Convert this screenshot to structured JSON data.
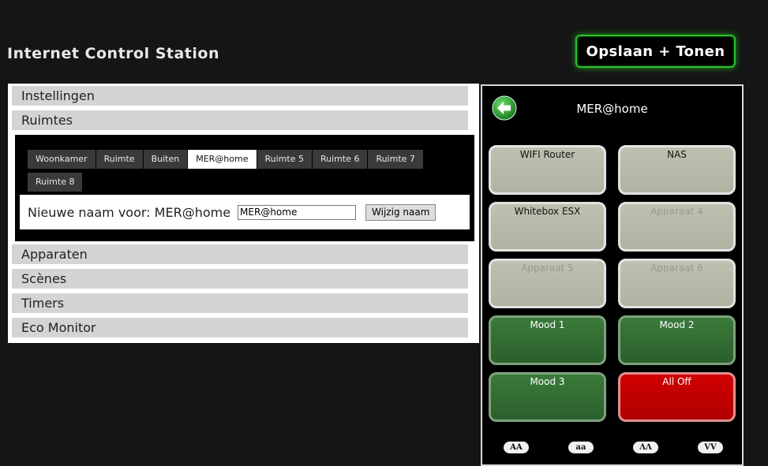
{
  "app": {
    "title": "Internet Control Station",
    "save_label": "Opslaan + Tonen"
  },
  "accordion": {
    "sections": [
      {
        "label": "Instellingen"
      },
      {
        "label": "Ruimtes"
      },
      {
        "label": "Apparaten"
      },
      {
        "label": "Scènes"
      },
      {
        "label": "Timers"
      },
      {
        "label": "Eco Monitor"
      }
    ],
    "open_section": "Ruimtes"
  },
  "rooms": {
    "tabs": [
      "Woonkamer",
      "Ruimte",
      "Buiten",
      "MER@home",
      "Ruimte 5",
      "Ruimte 6",
      "Ruimte 7",
      "Ruimte 8"
    ],
    "active_tab": "MER@home",
    "rename_label": "Nieuwe naam voor: MER@home",
    "rename_value": "MER@home",
    "rename_button": "Wijzig naam"
  },
  "remote": {
    "title": "MER@home",
    "buttons": [
      {
        "label": "WIFI Router",
        "style": "grey"
      },
      {
        "label": "NAS",
        "style": "grey"
      },
      {
        "label": "Whitebox ESX",
        "style": "grey"
      },
      {
        "label": "Apparaat 4",
        "style": "grey-dim"
      },
      {
        "label": "Apparaat 5",
        "style": "grey-dim"
      },
      {
        "label": "Apparaat 6",
        "style": "grey-dim"
      },
      {
        "label": "Mood 1",
        "style": "green"
      },
      {
        "label": "Mood 2",
        "style": "green"
      },
      {
        "label": "Mood 3",
        "style": "green"
      },
      {
        "label": "All Off",
        "style": "red"
      }
    ],
    "footer_buttons": [
      "AA",
      "aa",
      "ΛΛ",
      "VV"
    ]
  },
  "colors": {
    "background": "#151515",
    "accent_green": "#27c427",
    "red": "#cc0000"
  }
}
